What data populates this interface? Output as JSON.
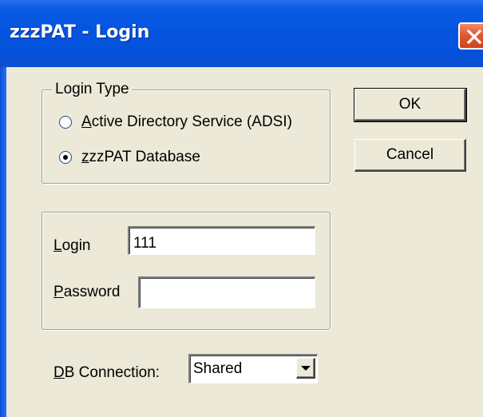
{
  "window": {
    "title": "zzzPAT - Login"
  },
  "login_type": {
    "group_label": "Login Type",
    "options": [
      {
        "label": "Active Directory Service (ADSI)",
        "checked": false
      },
      {
        "label": "zzzPAT Database",
        "checked": true
      }
    ]
  },
  "credentials": {
    "login_label": "Login",
    "login_value": "111",
    "password_label": "Password",
    "password_value": ""
  },
  "db_connection": {
    "label": "DB Connection:",
    "selected": "Shared"
  },
  "buttons": {
    "ok_label": "OK",
    "cancel_label": "Cancel"
  },
  "colors": {
    "titlebar": "#0454e0",
    "dialog_bg": "#ece9d8",
    "close_button": "#e05a30"
  },
  "icons": {
    "close": "close-icon",
    "dropdown": "chevron-down-icon"
  }
}
